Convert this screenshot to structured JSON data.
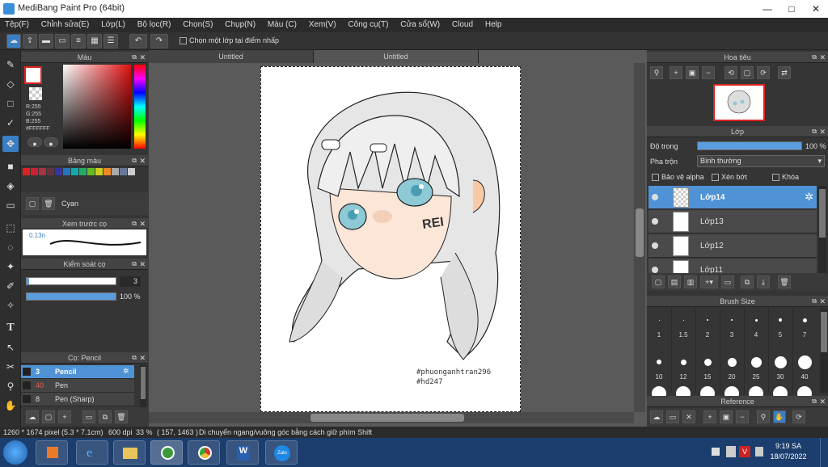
{
  "window": {
    "title": "MediBang Paint Pro (64bit)",
    "minimize": "—",
    "restore": "□",
    "close": "✕"
  },
  "menu": [
    "Tệp(F)",
    "Chỉnh sửa(E)",
    "Lớp(L)",
    "Bộ lọc(R)",
    "Chọn(S)",
    "Chụp(N)",
    "Màu (C)",
    "Xem(V)",
    "Công cụ(T)",
    "Cửa sổ(W)",
    "Cloud",
    "Help"
  ],
  "toolbar": {
    "checkbox_label": "Chọn một lớp tại điểm nhấp",
    "undo_icon": "undo-icon",
    "redo_icon": "redo-icon"
  },
  "tabs": [
    "Untitled",
    "Untitled"
  ],
  "color_panel": {
    "title": "Màu",
    "r": "R:255",
    "g": "G:255",
    "b": "B:255",
    "hex": "#FFFFFF"
  },
  "palette_panel": {
    "title": "Bảng màu",
    "selected_name": "Cyan",
    "swatches": [
      "#d22",
      "#c23",
      "#a34",
      "#634",
      "#33a",
      "#27b",
      "#1aa",
      "#2a6",
      "#6b2",
      "#cc2",
      "#e82",
      "#aaa",
      "#679",
      "#ccc"
    ]
  },
  "preview_panel": {
    "title": "Xem trước cọ",
    "size_text": "0.13n"
  },
  "brush_control": {
    "title": "Kiểm soát cọ",
    "size_value": "3",
    "opacity_value": "100 %",
    "opacity": 1.0
  },
  "brush_panel": {
    "title": "Cọ: Pencil",
    "items": [
      {
        "size": "3",
        "name": "Pencil",
        "selected": true
      },
      {
        "size": "40",
        "name": "Pen",
        "selected": false
      },
      {
        "size": "8",
        "name": "Pen (Sharp)",
        "selected": false
      }
    ]
  },
  "navigator": {
    "title": "Hoa tiêu"
  },
  "layer_panel": {
    "title": "Lớp",
    "opacity_label": "Độ trong",
    "opacity_value": "100 %",
    "opacity": 1.0,
    "blend_label": "Pha trộn",
    "blend_value": "Bình thường",
    "protect_alpha": "Bảo vệ alpha",
    "clip": "Xén bớt",
    "lock": "Khóa",
    "layers": [
      {
        "name": "Lớp14",
        "selected": true
      },
      {
        "name": "Lớp13",
        "selected": false
      },
      {
        "name": "Lớp12",
        "selected": false
      },
      {
        "name": "Lớp11",
        "selected": false
      }
    ]
  },
  "brush_size_panel": {
    "title": "Brush Size",
    "row1": [
      "1",
      "1.5",
      "2",
      "3",
      "4",
      "5",
      "7"
    ],
    "row2": [
      "10",
      "12",
      "15",
      "20",
      "25",
      "30",
      "40"
    ]
  },
  "reference_panel": {
    "title": "Reference"
  },
  "artwork": {
    "signature_line1": "#phuonganhtran296",
    "signature_line2": "#hd247",
    "graffiti_text": "REI"
  },
  "status": {
    "dims": "1260 * 1674 pixel",
    "cm": "(5.3 * 7.1cm)",
    "dpi": "600 dpi",
    "zoom": "33 %",
    "coords": "( 157, 1463 )",
    "hint": "Di chuyển ngang/vuông góc bằng cách giữ phím Shift"
  },
  "taskbar": {
    "time": "9:19 SA",
    "date": "18/07/2022",
    "zalo_label": "Zalo"
  }
}
